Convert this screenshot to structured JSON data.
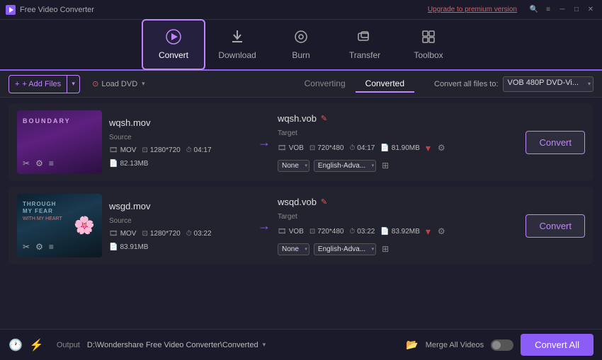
{
  "app": {
    "title": "Free Video Converter",
    "upgrade_label": "Upgrade to premium version"
  },
  "toolbar": {
    "nav_items": [
      {
        "id": "convert",
        "label": "Convert",
        "icon": "▶",
        "active": true
      },
      {
        "id": "download",
        "label": "Download",
        "icon": "⬇",
        "active": false
      },
      {
        "id": "burn",
        "label": "Burn",
        "icon": "⊙",
        "active": false
      },
      {
        "id": "transfer",
        "label": "Transfer",
        "icon": "⇄",
        "active": false
      },
      {
        "id": "toolbox",
        "label": "Toolbox",
        "icon": "⊞",
        "active": false
      }
    ]
  },
  "action_bar": {
    "add_files_label": "+ Add Files",
    "load_dvd_label": "Load DVD",
    "tab_converting": "Converting",
    "tab_converted": "Converted",
    "convert_all_to_label": "Convert all files to:",
    "format_value": "VOB 480P DVD-Vi..."
  },
  "videos": [
    {
      "filename": "wqsh.mov",
      "target_filename": "wqsh.vob",
      "source_format": "MOV",
      "source_resolution": "1280*720",
      "source_duration": "04:17",
      "source_size": "82.13MB",
      "target_format": "VOB",
      "target_resolution": "720*480",
      "target_duration": "04:17",
      "target_size": "81.90MB",
      "subtitle_dropdown": "None",
      "audio_dropdown": "English-Adva...",
      "convert_label": "Convert"
    },
    {
      "filename": "wsgd.mov",
      "target_filename": "wsqd.vob",
      "source_format": "MOV",
      "source_resolution": "1280*720",
      "source_duration": "03:22",
      "source_size": "83.91MB",
      "target_format": "VOB",
      "target_resolution": "720*480",
      "target_duration": "03:22",
      "target_size": "83.92MB",
      "subtitle_dropdown": "None",
      "audio_dropdown": "English-Adva...",
      "convert_label": "Convert"
    }
  ],
  "bottom_bar": {
    "output_label": "Output",
    "output_path": "D:\\Wondershare Free Video Converter\\Converted",
    "merge_label": "Merge All Videos",
    "convert_all_label": "Convert All"
  },
  "icons": {
    "add": "+",
    "arrow_down": "▾",
    "arrow_right": "→",
    "edit": "✎",
    "settings": "⊞",
    "search": "🔍",
    "menu": "≡",
    "minimize": "─",
    "maximize": "□",
    "close": "✕",
    "clock": "🕐",
    "lightning": "⚡",
    "folder": "📂",
    "cut": "✂",
    "list": "≡",
    "film": "🎞"
  }
}
